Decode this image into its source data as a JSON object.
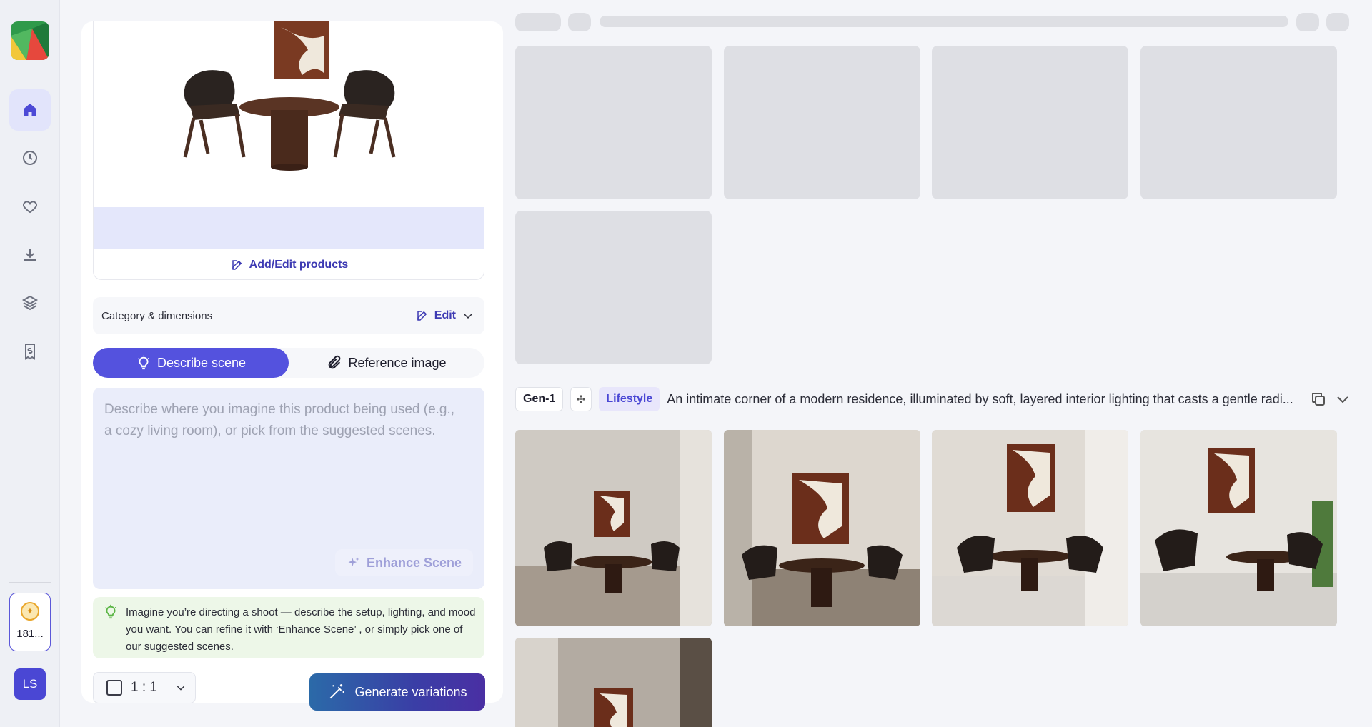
{
  "sidebar": {
    "logo": "brand-logo",
    "items": [
      {
        "name": "home",
        "icon": "home-icon",
        "active": true
      },
      {
        "name": "history",
        "icon": "clock-icon",
        "active": false
      },
      {
        "name": "favorites",
        "icon": "heart-icon",
        "active": false
      },
      {
        "name": "downloads",
        "icon": "download-icon",
        "active": false
      },
      {
        "name": "layers",
        "icon": "layers-icon",
        "active": false
      },
      {
        "name": "billing",
        "icon": "receipt-icon",
        "active": false
      }
    ],
    "credits": "181...",
    "avatar_initials": "LS"
  },
  "panel": {
    "add_edit_label": "Add/Edit products",
    "category_label": "Category & dimensions",
    "category_edit_label": "Edit",
    "tabs": [
      {
        "label": "Describe scene",
        "icon": "bulb-icon",
        "active": true
      },
      {
        "label": "Reference image",
        "icon": "paperclip-icon",
        "active": false
      }
    ],
    "scene_placeholder": "Describe where you imagine this product being used (e.g., a cozy living room), or pick from the suggested scenes.",
    "enhance_label": "Enhance Scene",
    "tip": "Imagine you’re directing a shoot — describe the setup, lighting, and mood you want. You can refine it with ‘Enhance Scene’ , or simply pick one of our suggested scenes.",
    "ratio_label": "1 : 1",
    "generate_label": "Generate variations"
  },
  "results": {
    "gen_label": "Gen-1",
    "style_label": "Lifestyle",
    "prompt": "An intimate corner of a modern residence, illuminated by soft, layered interior lighting that casts a gentle radi...",
    "colors": {
      "accent": "#5452de",
      "link": "#3d3ab3",
      "skeleton": "#dedfe4",
      "tip_bg": "#edf7e8"
    }
  }
}
